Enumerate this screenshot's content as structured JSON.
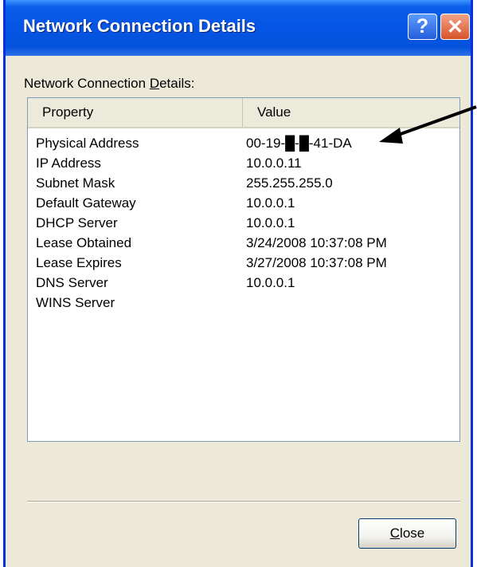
{
  "window": {
    "title": "Network Connection Details",
    "help_glyph": "?",
    "close_glyph": "✕"
  },
  "group": {
    "label_pre": "Network Connection ",
    "label_accel": "D",
    "label_post": "etails:"
  },
  "list": {
    "headers": {
      "property": "Property",
      "value": "Value"
    },
    "rows": [
      {
        "property": "Physical Address",
        "value": "00-19-█-█-41-DA"
      },
      {
        "property": "IP Address",
        "value": "10.0.0.11"
      },
      {
        "property": "Subnet Mask",
        "value": "255.255.255.0"
      },
      {
        "property": "Default Gateway",
        "value": "10.0.0.1"
      },
      {
        "property": "DHCP Server",
        "value": "10.0.0.1"
      },
      {
        "property": "Lease Obtained",
        "value": "3/24/2008 10:37:08 PM"
      },
      {
        "property": "Lease Expires",
        "value": "3/27/2008 10:37:08 PM"
      },
      {
        "property": "DNS Server",
        "value": "10.0.0.1"
      },
      {
        "property": "WINS Server",
        "value": ""
      }
    ]
  },
  "footer": {
    "close_accel": "C",
    "close_rest": "lose"
  },
  "colors": {
    "titlebar": "#0554e4",
    "dialog_bg": "#ece9d8",
    "close_btn": "#d7532a"
  }
}
